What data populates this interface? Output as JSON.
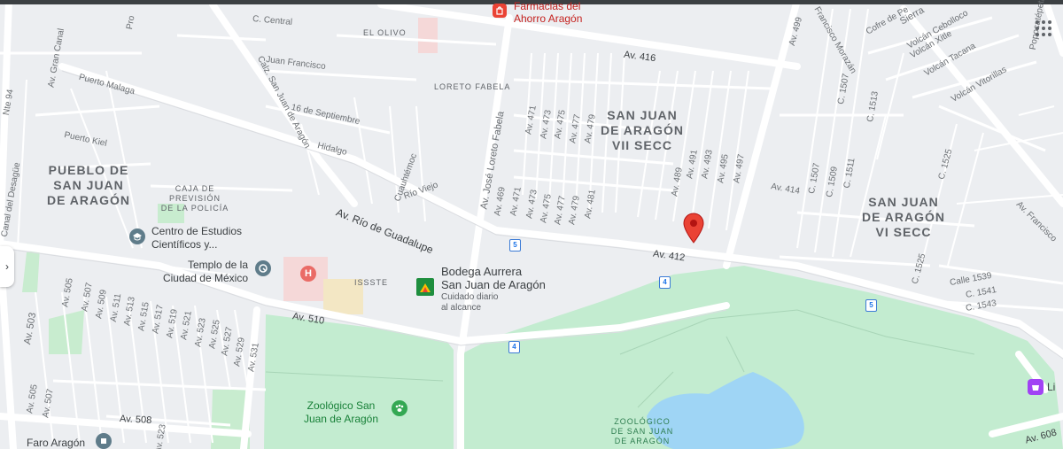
{
  "map": {
    "neighborhoods": {
      "sj_vii": [
        "SAN JUAN",
        "DE ARAGÓN",
        "VII SECC"
      ],
      "sj_vi": [
        "SAN JUAN",
        "DE ARAGÓN",
        "VI SECC"
      ],
      "pueblo": [
        "PUEBLO DE",
        "SAN JUAN",
        "DE ARAGÓN"
      ],
      "olivo": "EL OLIVO",
      "loreto": "LORETO FABELA"
    },
    "roads": {
      "rio_guadalupe": "Av. Río de Guadalupe",
      "av412": "Av. 412",
      "av416": "Av. 416",
      "av510": "Av. 510",
      "av508": "Av. 508",
      "av608": "Av. 608",
      "av414": "Av. 414",
      "av499": "Av. 499",
      "calz_sja": "Calz. San Juan de Aragón",
      "puerto_malaga": "Puerto Malaga",
      "puerto_kiel": "Puerto Kiel",
      "juan_francisco": "Juan Francisco",
      "c_central": "C. Central",
      "sept16": "16 de Septiembre",
      "hidalgo": "Hidalgo",
      "cuauhtemoc": "Cuauhtémoc",
      "rio_viejo": "Río Viejo",
      "jose_loreto": "Av. José Loreto Fabela",
      "gran_canal": "Av. Gran Canal",
      "canal_desague": "Canal del Desagüe",
      "francisco_morazan": "Francisco Morazán",
      "av_francisco": "Av. Francisco",
      "nte94": "Nte 94",
      "volcan_vitorillas": "Volcán Vitorillas",
      "volcan_tacana": "Volcán Tacana",
      "volcan_xitle": "Volcán Xitle",
      "volcan_cebolloco": "Volcán Cebolloco",
      "sierra": "Sierra",
      "cofre": "Cofre de Pe",
      "calle1539": "Calle 1539",
      "c1541": "C. 1541",
      "c1543": "C. 1543",
      "c1525": "C. 1525",
      "c1525b": "C. 1525",
      "c1507": "C. 1507",
      "c1507b": "C. 1507",
      "c1509": "C. 1509",
      "c1511": "C. 1511",
      "c1513": "C. 1513",
      "popocatepetl": "Popocatépetl",
      "issste": "ISSSTE",
      "pro": "Pro"
    },
    "avs_top": [
      "Av. 469",
      "Av. 471",
      "Av. 473",
      "Av. 475",
      "Av. 477",
      "Av. 479",
      "Av. 481"
    ],
    "avs_top2": [
      "Av. 471",
      "Av. 473",
      "Av. 475",
      "Av. 477",
      "Av. 479"
    ],
    "avs_right": [
      "Av. 489",
      "Av. 491",
      "Av. 493",
      "Av. 495",
      "Av. 497"
    ],
    "avs_left": [
      "Av. 505",
      "Av. 507",
      "Av. 509",
      "Av. 511",
      "Av. 513",
      "Av. 515",
      "Av. 517",
      "Av. 519",
      "Av. 521",
      "Av. 523",
      "Av. 525",
      "Av. 527",
      "Av. 529",
      "Av. 531"
    ],
    "avs_left2": [
      "Av. 503",
      "Av. 505",
      "Av. 507",
      "Av. 523"
    ],
    "shields": [
      "5",
      "5",
      "4",
      "4",
      "5"
    ],
    "pois": {
      "farmacia": [
        "Farmacias del",
        "Ahorro Aragón"
      ],
      "bodega": [
        "Bodega Aurrera",
        "San Juan de Aragón"
      ],
      "bodega_sub": [
        "Cuidado diario",
        "al alcance"
      ],
      "centro": [
        "Centro de Estudios",
        "Científicos y..."
      ],
      "templo": [
        "Templo de la",
        "Ciudad de México"
      ],
      "caja": [
        "CAJA DE",
        "PREVISIÓN",
        "DE LA POLICÍA"
      ],
      "zoo": [
        "Zoológico San",
        "Juan de Aragón"
      ],
      "zoo_caps": [
        "ZOOLÓGICO",
        "DE SAN JUAN",
        "DE ARAGÓN"
      ],
      "faro": "Faro Aragón",
      "li": "Li"
    },
    "icons": {
      "farmacia": "shopping-bag-icon",
      "bodega": "store-icon",
      "hospital": "hospital-icon",
      "centro": "school-icon",
      "templo": "landmark-icon",
      "zoo": "paw-icon",
      "faro": "museum-icon",
      "li": "shop-icon",
      "pin": "location-pin-icon",
      "apps": "apps-grid-icon",
      "side": "chevron-right-icon"
    },
    "colors": {
      "park": "#c3ecd0",
      "water": "#9fd5f5",
      "pin": "#ea4335",
      "hospital": "#ea6b66",
      "shield": "#1a73e8"
    }
  }
}
